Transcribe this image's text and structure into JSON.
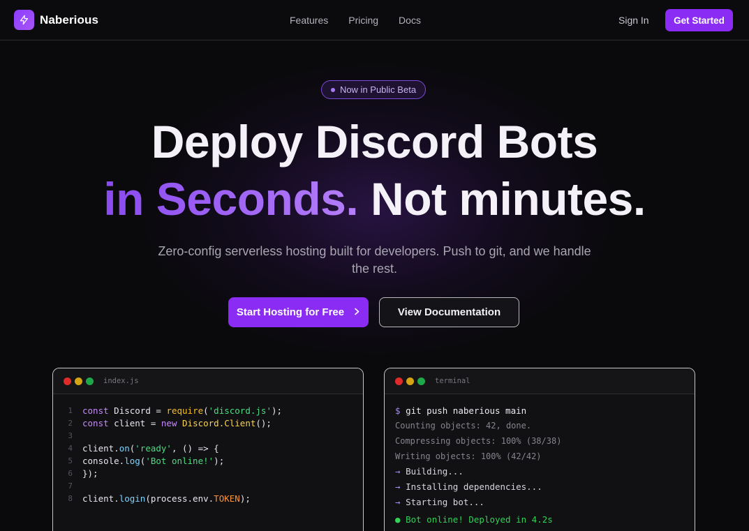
{
  "nav": {
    "brand": "Naberious",
    "links": [
      "Features",
      "Pricing",
      "Docs"
    ],
    "sign_in": "Sign In",
    "get_started": "Get Started"
  },
  "hero": {
    "badge": "Now in Public Beta",
    "title_line1": "Deploy Discord Bots",
    "title_line2_accent": "in Seconds.",
    "title_line2_rest": "Not minutes.",
    "subtitle": "Zero-config serverless hosting built for developers. Push to git, and we handle the rest.",
    "primary_cta": "Start Hosting for Free",
    "secondary_cta": "View Documentation"
  },
  "editor": {
    "filename": "index.js",
    "line_numbers": [
      "1",
      "2",
      "3",
      "4",
      "5",
      "6",
      "7",
      "8"
    ]
  },
  "terminal": {
    "title": "terminal",
    "command": "git push naberious main",
    "output": [
      "Counting objects: 42, done.",
      "Compressing objects: 100% (38/38)",
      "Writing objects: 100% (42/42)"
    ],
    "steps": [
      "Building...",
      "Installing dependencies...",
      "Starting bot..."
    ],
    "success": "Bot online! Deployed in 4.2s"
  },
  "colors": {
    "accent": "#8b2cf5",
    "background": "#0a0a0c",
    "success": "#34d058"
  },
  "icons": {
    "brand": "lightning-bolt-icon",
    "cta": "chevron-right-icon"
  }
}
